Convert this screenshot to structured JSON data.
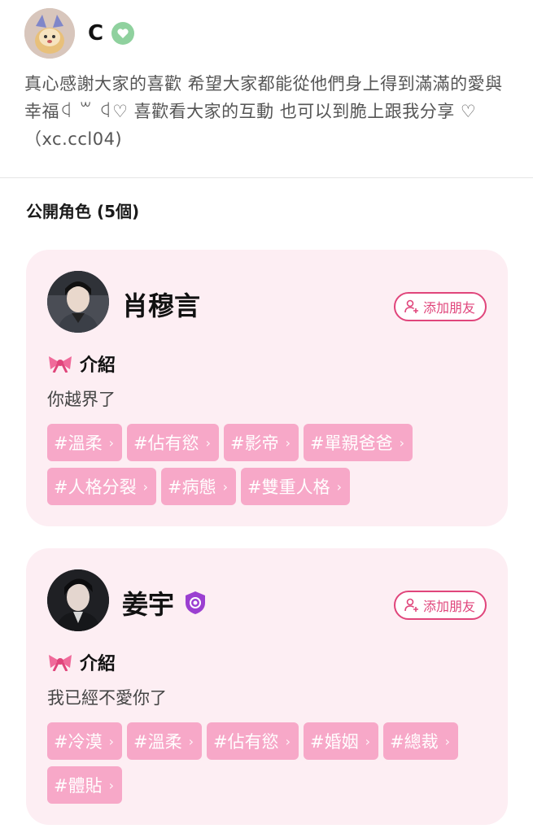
{
  "profile": {
    "username": "C",
    "bio": "真心感謝大家的喜歡 希望大家都能從他們身上得到滿滿的愛與幸福ꒉ ꒳ ꒉ♡ 喜歡看大家的互動 也可以到脆上跟我分享 ♡（xc.ccl04)"
  },
  "section": {
    "title": "公開角色 (5個)"
  },
  "characters": [
    {
      "name": "肖穆言",
      "add_friend_label": "添加朋友",
      "intro_label": "介紹",
      "intro_text": "你越界了",
      "tags": [
        "#溫柔",
        "#佔有慾",
        "#影帝",
        "#單親爸爸",
        "#人格分裂",
        "#病態",
        "#雙重人格"
      ]
    },
    {
      "name": "姜宇",
      "add_friend_label": "添加朋友",
      "intro_label": "介紹",
      "intro_text": "我已經不愛你了",
      "tags": [
        "#冷漠",
        "#溫柔",
        "#佔有慾",
        "#婚姻",
        "#總裁",
        "#體貼"
      ]
    }
  ],
  "icons": {
    "verified": "heart-badge-icon",
    "shield": "shield-badge-icon",
    "add_friend": "add-person-icon",
    "intro": "bow-icon",
    "tag_arrow": "chevron-right-icon"
  },
  "colors": {
    "card_bg": "#fdeef3",
    "tag_bg": "#f7a8c8",
    "accent": "#e0457b",
    "verified_green": "#8fd19e",
    "shield_purple": "#9b3fd1"
  }
}
